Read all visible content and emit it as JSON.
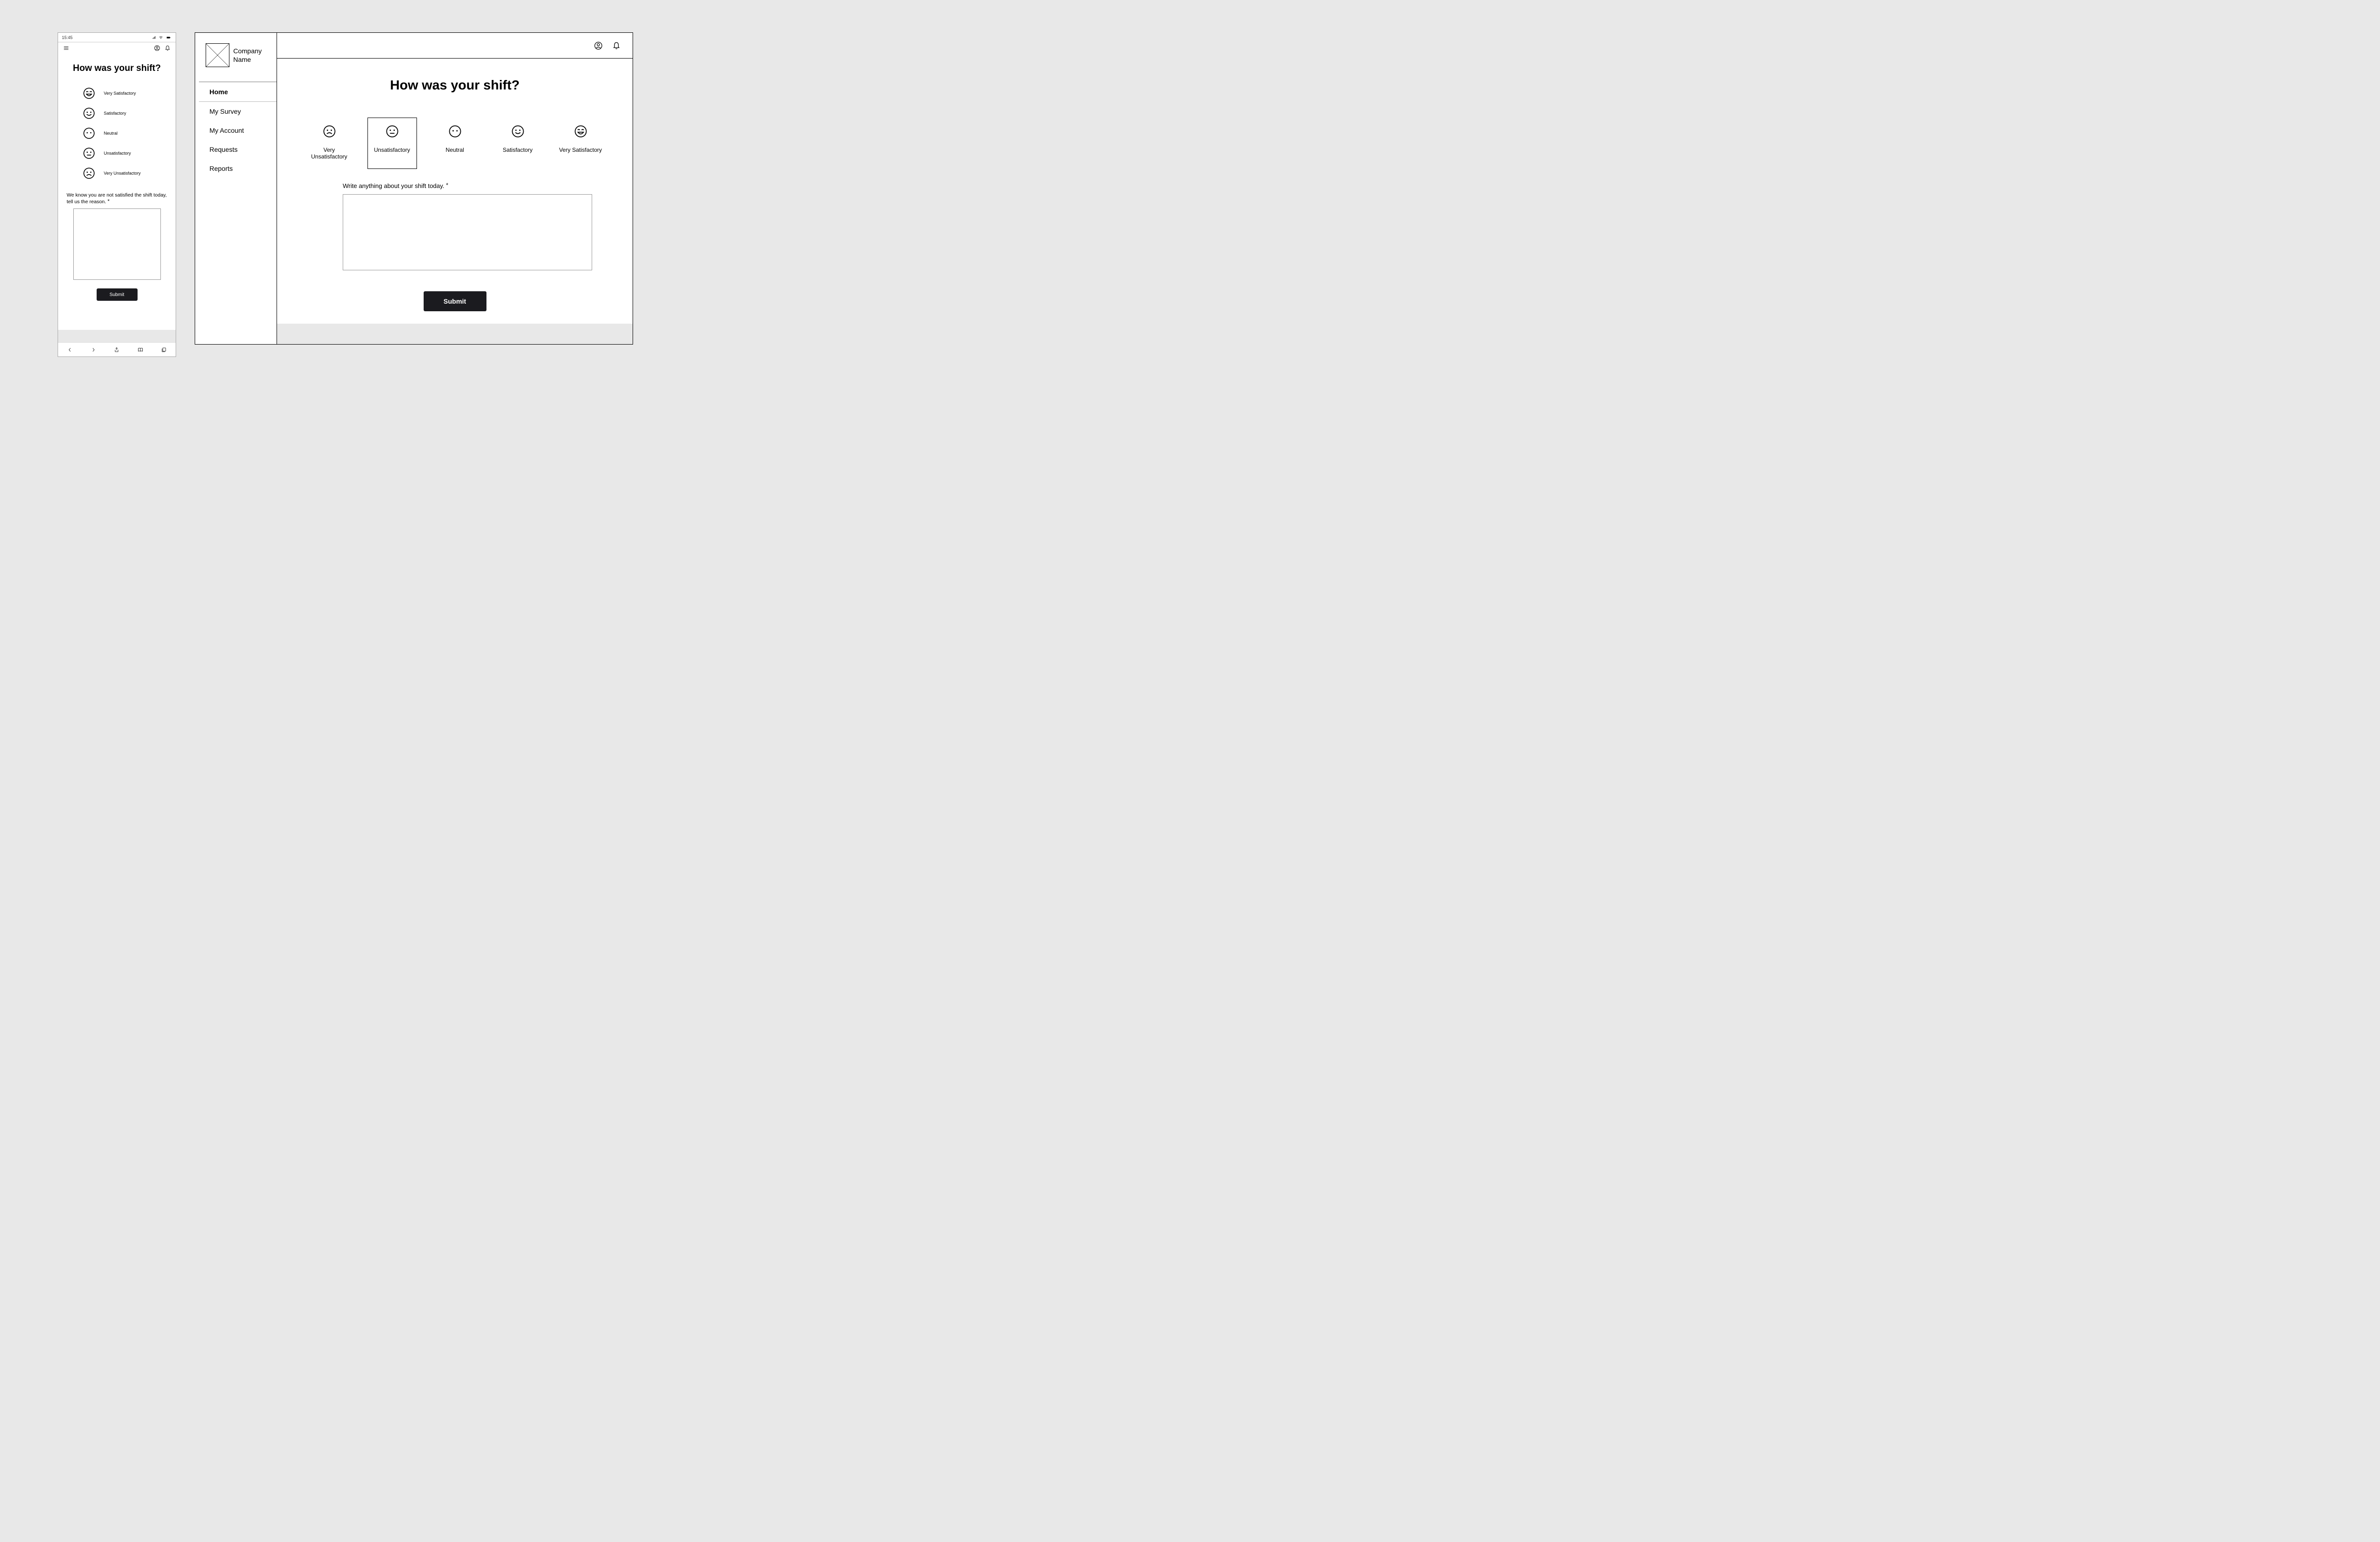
{
  "mobile": {
    "time": "15:45",
    "title": "How was your shift?",
    "options": [
      {
        "label": "Very Satisfactory",
        "mood": "very-satisfactory"
      },
      {
        "label": "Satisfactory",
        "mood": "satisfactory"
      },
      {
        "label": "Neutral",
        "mood": "neutral"
      },
      {
        "label": "Unsatisfactory",
        "mood": "unsatisfactory"
      },
      {
        "label": "Very Unsatisfactory",
        "mood": "very-unsatisfactory"
      }
    ],
    "prompt": "We know you are not satisfied the shift today, tell us the reason.",
    "required_mark": "*",
    "submit": "Submit"
  },
  "desktop": {
    "company_line1": "Company",
    "company_line2": "Name",
    "nav": {
      "home": "Home",
      "survey": "My Survey",
      "account": "My Account",
      "requests": "Requests",
      "reports": "Reports"
    },
    "title": "How was your shift?",
    "options": [
      {
        "label": "Very Unsatisfactory",
        "mood": "very-unsatisfactory",
        "selected": false
      },
      {
        "label": "Unsatisfactory",
        "mood": "unsatisfactory",
        "selected": true
      },
      {
        "label": "Neutral",
        "mood": "neutral",
        "selected": false
      },
      {
        "label": "Satisfactory",
        "mood": "satisfactory",
        "selected": false
      },
      {
        "label": "Very Satisfactory",
        "mood": "very-satisfactory",
        "selected": false
      }
    ],
    "prompt": "Write anything about your shift today.",
    "required_mark": "*",
    "submit": "Submit"
  }
}
